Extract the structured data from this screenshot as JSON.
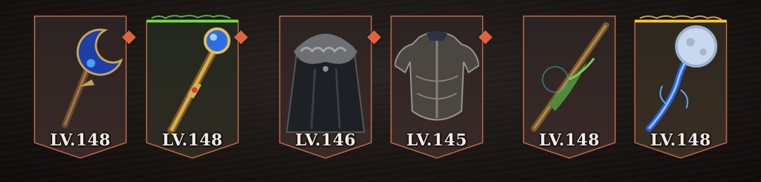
{
  "equipment": [
    {
      "level_label": "LV.148",
      "item_icon": "crescent-staff-icon",
      "rarity_color": "#c86a48",
      "has_badge": true
    },
    {
      "level_label": "LV.148",
      "item_icon": "orb-scepter-icon",
      "rarity_color": "#6fdc3a",
      "has_badge": true
    },
    {
      "level_label": "LV.146",
      "item_icon": "fur-cloak-icon",
      "rarity_color": "#c86a48",
      "has_badge": true
    },
    {
      "level_label": "LV.145",
      "item_icon": "plate-armor-icon",
      "rarity_color": "#c86a48",
      "has_badge": true
    },
    {
      "level_label": "LV.148",
      "item_icon": "vine-wand-icon",
      "rarity_color": "#c86a48",
      "has_badge": false
    },
    {
      "level_label": "LV.148",
      "item_icon": "moon-staff-icon",
      "rarity_color": "#f2c23a",
      "has_badge": false
    }
  ],
  "colors": {
    "badge": "#e0633f",
    "frame_border": "#c86a48",
    "green_glow": "#6fdc3a",
    "gold_glow": "#f2c23a"
  }
}
